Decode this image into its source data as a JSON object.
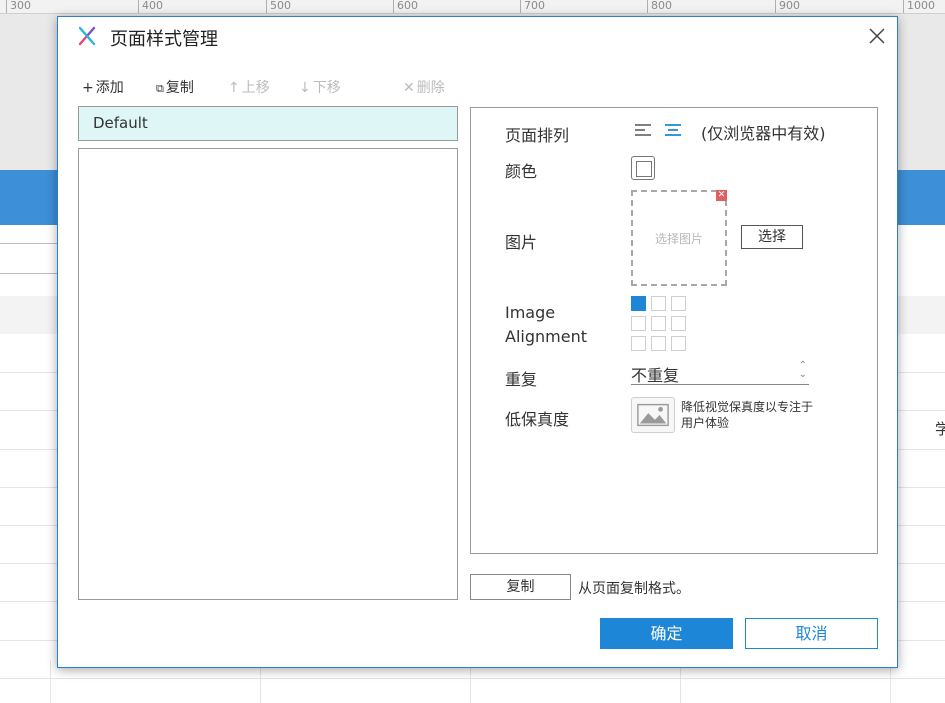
{
  "ruler": {
    "ticks": [
      "300",
      "400",
      "500",
      "600",
      "700",
      "800",
      "900",
      "1000"
    ]
  },
  "background": {
    "partial_char": "学"
  },
  "dialog": {
    "title": "页面样式管理",
    "toolbar": {
      "add": "添加",
      "copy": "复制",
      "move_up": "上移",
      "move_down": "下移",
      "delete": "删除"
    },
    "styles_list": {
      "items": [
        "Default"
      ]
    },
    "properties": {
      "page_align_label": "页面排列",
      "page_align_note": "(仅浏览器中有效)",
      "color_label": "颜色",
      "image_label": "图片",
      "image_placeholder": "选择图片",
      "select_button": "选择",
      "image_alignment_label_1": "Image",
      "image_alignment_label_2": "Alignment",
      "repeat_label": "重复",
      "repeat_value": "不重复",
      "low_fidelity_label": "低保真度",
      "low_fidelity_desc": "降低视觉保真度以专注于用户体验"
    },
    "copy_button": "复制",
    "copy_hint": "从页面复制格式。",
    "ok_button": "确定",
    "cancel_button": "取消"
  },
  "colors": {
    "accent": "#1e86d6",
    "selected_row": "#dff6f6",
    "header_blue": "#3d8fd8"
  }
}
